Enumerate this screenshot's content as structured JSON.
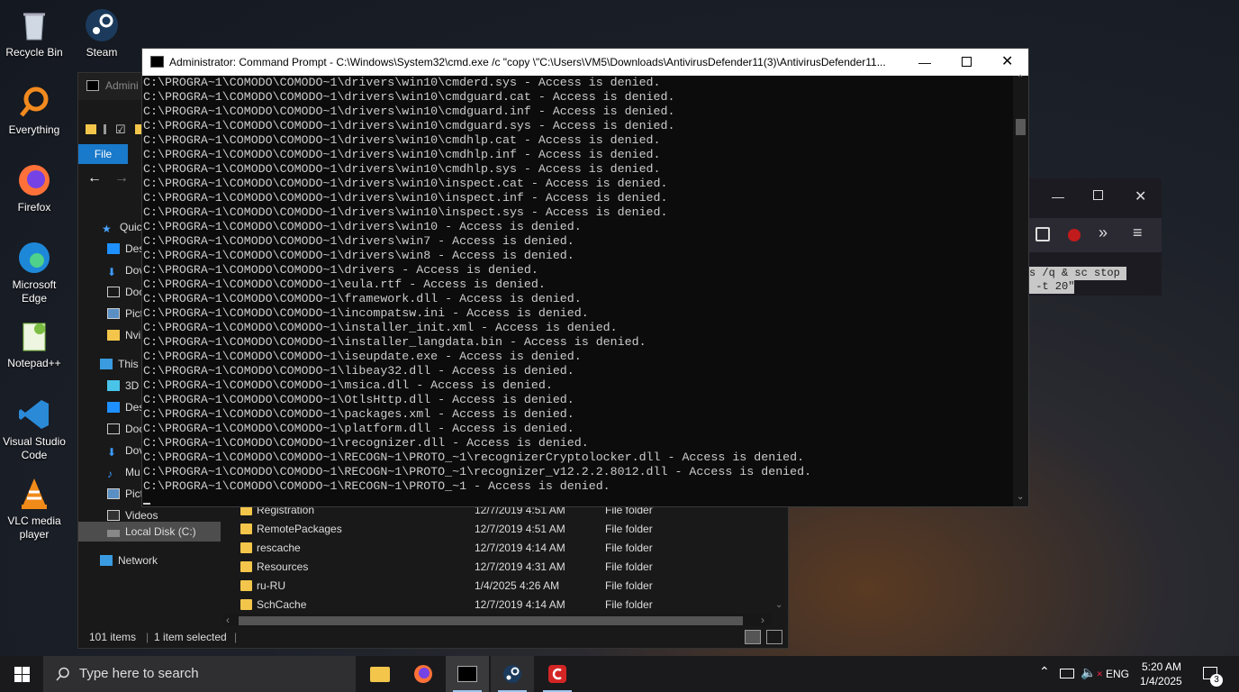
{
  "desktop_icons": [
    {
      "label": "Recycle Bin",
      "icon": "recycle-bin-icon"
    },
    {
      "label": "Steam",
      "icon": "steam-icon"
    },
    {
      "label": "Everything",
      "icon": "everything-icon"
    },
    {
      "label": "Firefox",
      "icon": "firefox-icon"
    },
    {
      "label": "Microsoft Edge",
      "icon": "edge-icon"
    },
    {
      "label": "Notepad++",
      "icon": "notepadpp-icon"
    },
    {
      "label": "Visual Studio Code",
      "icon": "vscode-icon"
    },
    {
      "label": "VLC media player",
      "icon": "vlc-icon"
    }
  ],
  "cmd": {
    "title": "Administrator: Command Prompt - C:\\Windows\\System32\\cmd.exe  /c \"copy \\\"C:\\Users\\VM5\\Downloads\\AntivirusDefender11(3)\\AntivirusDefender11...",
    "lines": [
      "C:\\PROGRA~1\\COMODO\\COMODO~1\\drivers\\win10\\cmderd.sys - Access is denied.",
      "C:\\PROGRA~1\\COMODO\\COMODO~1\\drivers\\win10\\cmdguard.cat - Access is denied.",
      "C:\\PROGRA~1\\COMODO\\COMODO~1\\drivers\\win10\\cmdguard.inf - Access is denied.",
      "C:\\PROGRA~1\\COMODO\\COMODO~1\\drivers\\win10\\cmdguard.sys - Access is denied.",
      "C:\\PROGRA~1\\COMODO\\COMODO~1\\drivers\\win10\\cmdhlp.cat - Access is denied.",
      "C:\\PROGRA~1\\COMODO\\COMODO~1\\drivers\\win10\\cmdhlp.inf - Access is denied.",
      "C:\\PROGRA~1\\COMODO\\COMODO~1\\drivers\\win10\\cmdhlp.sys - Access is denied.",
      "C:\\PROGRA~1\\COMODO\\COMODO~1\\drivers\\win10\\inspect.cat - Access is denied.",
      "C:\\PROGRA~1\\COMODO\\COMODO~1\\drivers\\win10\\inspect.inf - Access is denied.",
      "C:\\PROGRA~1\\COMODO\\COMODO~1\\drivers\\win10\\inspect.sys - Access is denied.",
      "C:\\PROGRA~1\\COMODO\\COMODO~1\\drivers\\win10 - Access is denied.",
      "C:\\PROGRA~1\\COMODO\\COMODO~1\\drivers\\win7 - Access is denied.",
      "C:\\PROGRA~1\\COMODO\\COMODO~1\\drivers\\win8 - Access is denied.",
      "C:\\PROGRA~1\\COMODO\\COMODO~1\\drivers - Access is denied.",
      "C:\\PROGRA~1\\COMODO\\COMODO~1\\eula.rtf - Access is denied.",
      "C:\\PROGRA~1\\COMODO\\COMODO~1\\framework.dll - Access is denied.",
      "C:\\PROGRA~1\\COMODO\\COMODO~1\\incompatsw.ini - Access is denied.",
      "C:\\PROGRA~1\\COMODO\\COMODO~1\\installer_init.xml - Access is denied.",
      "C:\\PROGRA~1\\COMODO\\COMODO~1\\installer_langdata.bin - Access is denied.",
      "C:\\PROGRA~1\\COMODO\\COMODO~1\\iseupdate.exe - Access is denied.",
      "C:\\PROGRA~1\\COMODO\\COMODO~1\\libeay32.dll - Access is denied.",
      "C:\\PROGRA~1\\COMODO\\COMODO~1\\msica.dll - Access is denied.",
      "C:\\PROGRA~1\\COMODO\\COMODO~1\\OtlsHttp.dll - Access is denied.",
      "C:\\PROGRA~1\\COMODO\\COMODO~1\\packages.xml - Access is denied.",
      "C:\\PROGRA~1\\COMODO\\COMODO~1\\platform.dll - Access is denied.",
      "C:\\PROGRA~1\\COMODO\\COMODO~1\\recognizer.dll - Access is denied.",
      "C:\\PROGRA~1\\COMODO\\COMODO~1\\RECOGN~1\\PROTO_~1\\recognizerCryptolocker.dll - Access is denied.",
      "C:\\PROGRA~1\\COMODO\\COMODO~1\\RECOGN~1\\PROTO_~1\\recognizer_v12.2.2.8012.dll - Access is denied.",
      "C:\\PROGRA~1\\COMODO\\COMODO~1\\RECOGN~1\\PROTO_~1 - Access is denied."
    ]
  },
  "explorer": {
    "title_partial": "Admini",
    "ribbon_file_tab": "File",
    "nav_items": [
      {
        "label": "Quick",
        "icon": "star-icon"
      },
      {
        "label": "Des",
        "icon": "desktop-icon"
      },
      {
        "label": "Dov",
        "icon": "download-icon"
      },
      {
        "label": "Doc",
        "icon": "document-icon"
      },
      {
        "label": "Pict",
        "icon": "picture-icon"
      },
      {
        "label": "Nvi",
        "icon": "folder-icon"
      },
      {
        "label": "This",
        "icon": "pc-icon"
      },
      {
        "label": "3D",
        "icon": "cube-icon"
      },
      {
        "label": "Des",
        "icon": "desktop-icon"
      },
      {
        "label": "Doc",
        "icon": "document-icon"
      },
      {
        "label": "Dov",
        "icon": "download-icon"
      },
      {
        "label": "Mu",
        "icon": "music-icon"
      },
      {
        "label": "Pict",
        "icon": "picture-icon"
      },
      {
        "label": "Videos",
        "icon": "video-icon"
      },
      {
        "label": "Local Disk (C:)",
        "icon": "drive-icon"
      },
      {
        "label": "Network",
        "icon": "network-icon"
      }
    ],
    "files": [
      {
        "name": "Registration",
        "date": "12/7/2019 4:51 AM",
        "type": "File folder"
      },
      {
        "name": "RemotePackages",
        "date": "12/7/2019 4:51 AM",
        "type": "File folder"
      },
      {
        "name": "rescache",
        "date": "12/7/2019 4:14 AM",
        "type": "File folder"
      },
      {
        "name": "Resources",
        "date": "12/7/2019 4:31 AM",
        "type": "File folder"
      },
      {
        "name": "ru-RU",
        "date": "1/4/2025 4:26 AM",
        "type": "File folder"
      },
      {
        "name": "SchCache",
        "date": "12/7/2019 4:14 AM",
        "type": "File folder"
      }
    ],
    "status": {
      "items": "101 items",
      "selected": "1 item selected"
    }
  },
  "browser_selected_text": [
    "s /q & sc stop ",
    " -t 20\""
  ],
  "taskbar": {
    "search_placeholder": "Type here to search",
    "language": "ENG",
    "time": "5:20 AM",
    "date": "1/4/2025",
    "notification_count": "3"
  }
}
